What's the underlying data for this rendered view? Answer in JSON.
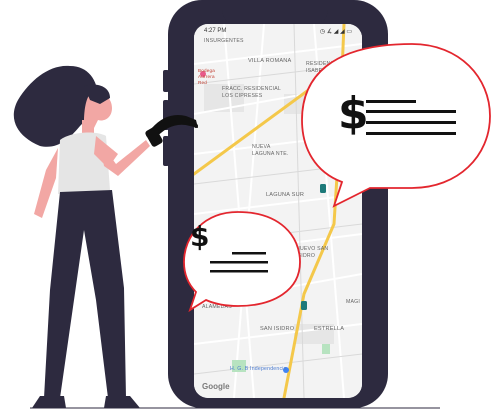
{
  "status_bar": {
    "time": "4:27 PM",
    "icons": "◷ ∡ ◢ ◢ ▭"
  },
  "map": {
    "labels": [
      {
        "id": "insurgentes",
        "text": "INSURGENTES"
      },
      {
        "id": "villa-romana",
        "text": "VILLA ROMANA"
      },
      {
        "id": "residencial-isabeles",
        "text": "RESIDENCIAL LAS ISABELES"
      },
      {
        "id": "fracc-cipreses",
        "text": "FRACC. RESIDENCIAL LOS CIPRESES"
      },
      {
        "id": "villa-fl",
        "text": "VILLA FL"
      },
      {
        "id": "nueva-laguna",
        "text": "NUEVA LAGUNA NTE."
      },
      {
        "id": "sin-nombre",
        "text": "SIN NOMBRE DE COL 3"
      },
      {
        "id": "laguna-sur",
        "text": "LAGUNA SUR"
      },
      {
        "id": "nuevo-san-isidro",
        "text": "NUEVO SAN ISIDRO"
      },
      {
        "id": "alamedas",
        "text": "ALAMEDAS"
      },
      {
        "id": "magi",
        "text": "MAGI"
      },
      {
        "id": "san-isidro",
        "text": "SAN ISIDRO"
      },
      {
        "id": "estrella",
        "text": "ESTRELLA"
      },
      {
        "id": "hgb",
        "text": "H. G. B Independencia"
      }
    ],
    "poi_text": "Bodega Aurrera Red",
    "google_logo": "Google"
  },
  "bubbles": {
    "large": {
      "currency_symbol": "$"
    },
    "small": {
      "currency_symbol": "$"
    }
  },
  "colors": {
    "phone_frame": "#2d2a3f",
    "bubble_border": "#e3262e",
    "woman_hair": "#2d2a3f",
    "woman_pants": "#2d2a3f",
    "woman_skin": "#f2a7a4",
    "map_road": "#f4c84a"
  }
}
